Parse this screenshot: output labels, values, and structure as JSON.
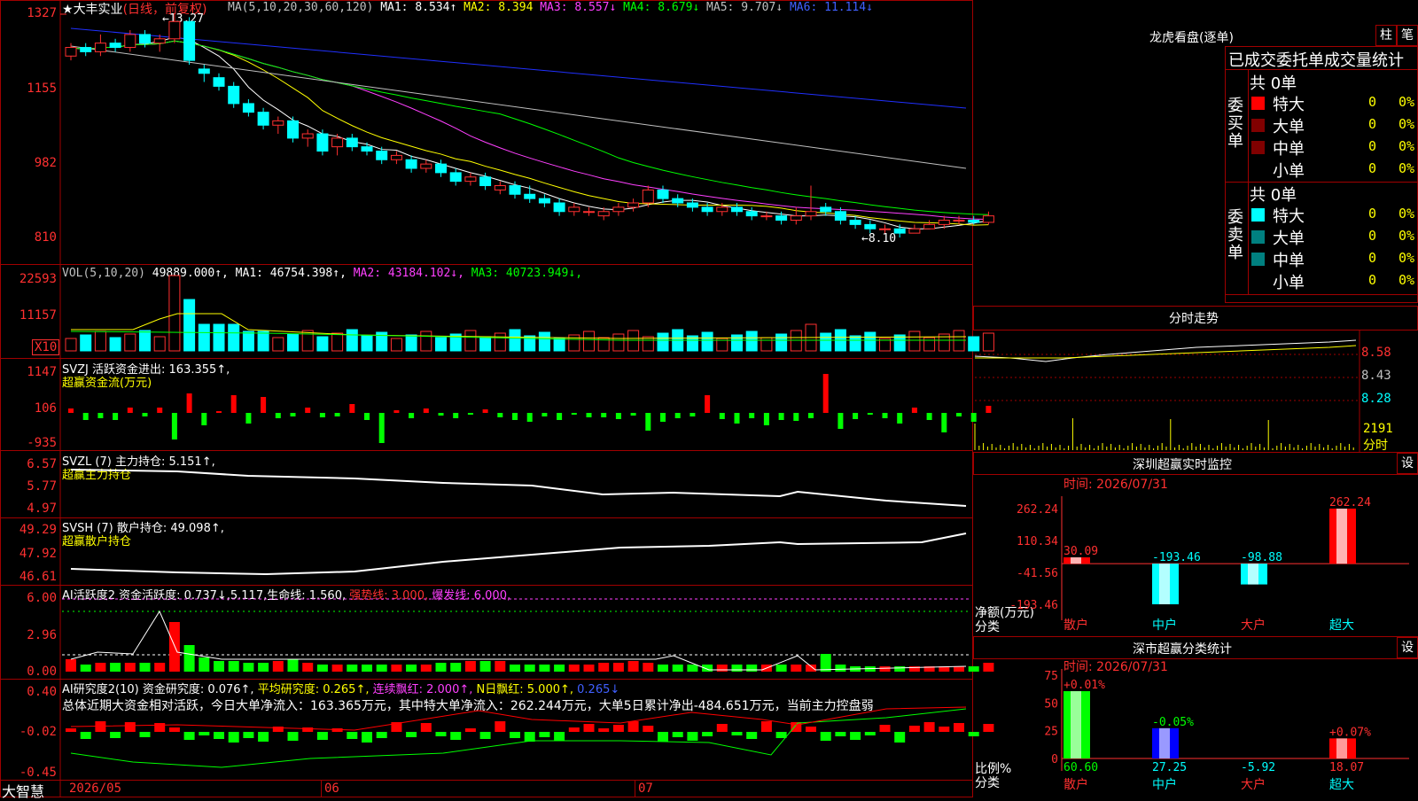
{
  "stock": {
    "name": "大丰实业",
    "period": "(日线，前复权)",
    "prefix": "★"
  },
  "app_name": "大智慧",
  "main_panel": {
    "ma_prefix": "MA(5,10,20,30,60,120)",
    "ma": [
      {
        "label": "MA1: 8.534↑",
        "color": "#ffffff"
      },
      {
        "label": "MA2: 8.394",
        "color": "#ffff00"
      },
      {
        "label": "MA3: 8.557↓",
        "color": "#ff40ff"
      },
      {
        "label": "MA4: 8.679↓",
        "color": "#00ff00"
      },
      {
        "label": "MA5: 9.707↓",
        "color": "#c0c0c0"
      },
      {
        "label": "MA6: 11.114↓",
        "color": "#4060ff"
      }
    ],
    "axis": [
      "1327",
      "1155",
      "982",
      "810"
    ],
    "high_label": "13.27",
    "low_label": "8.10",
    "candles": [
      [
        12.3,
        12.6,
        12.2,
        12.5
      ],
      [
        12.5,
        12.6,
        12.3,
        12.4
      ],
      [
        12.4,
        12.8,
        12.3,
        12.6
      ],
      [
        12.6,
        12.7,
        12.4,
        12.5
      ],
      [
        12.5,
        12.9,
        12.4,
        12.8
      ],
      [
        12.8,
        12.9,
        12.5,
        12.6
      ],
      [
        12.6,
        12.8,
        12.4,
        12.7
      ],
      [
        12.7,
        13.27,
        12.6,
        13.1
      ],
      [
        13.1,
        13.2,
        12.1,
        12.2
      ],
      [
        12.0,
        12.1,
        11.7,
        11.9
      ],
      [
        11.8,
        11.9,
        11.5,
        11.6
      ],
      [
        11.6,
        11.7,
        11.1,
        11.2
      ],
      [
        11.2,
        11.3,
        10.9,
        11.0
      ],
      [
        11.0,
        11.1,
        10.6,
        10.7
      ],
      [
        10.7,
        10.9,
        10.5,
        10.8
      ],
      [
        10.8,
        10.9,
        10.3,
        10.4
      ],
      [
        10.4,
        10.6,
        10.2,
        10.5
      ],
      [
        10.5,
        10.6,
        10.0,
        10.1
      ],
      [
        10.2,
        10.5,
        10.0,
        10.4
      ],
      [
        10.4,
        10.5,
        10.1,
        10.2
      ],
      [
        10.2,
        10.3,
        10.0,
        10.1
      ],
      [
        10.1,
        10.2,
        9.8,
        9.9
      ],
      [
        9.9,
        10.1,
        9.8,
        10.0
      ],
      [
        9.9,
        10.0,
        9.6,
        9.7
      ],
      [
        9.7,
        9.9,
        9.6,
        9.8
      ],
      [
        9.8,
        9.9,
        9.5,
        9.6
      ],
      [
        9.6,
        9.7,
        9.3,
        9.4
      ],
      [
        9.4,
        9.6,
        9.3,
        9.5
      ],
      [
        9.5,
        9.6,
        9.2,
        9.3
      ],
      [
        9.2,
        9.4,
        9.1,
        9.3
      ],
      [
        9.3,
        9.4,
        9.0,
        9.1
      ],
      [
        9.1,
        9.3,
        8.9,
        9.0
      ],
      [
        9.0,
        9.1,
        8.8,
        8.9
      ],
      [
        8.9,
        9.0,
        8.6,
        8.7
      ],
      [
        8.7,
        8.9,
        8.6,
        8.8
      ],
      [
        8.7,
        8.8,
        8.6,
        8.7
      ],
      [
        8.6,
        8.8,
        8.5,
        8.7
      ],
      [
        8.7,
        8.9,
        8.6,
        8.8
      ],
      [
        8.8,
        9.0,
        8.7,
        8.9
      ],
      [
        8.9,
        9.3,
        8.8,
        9.2
      ],
      [
        9.2,
        9.3,
        8.9,
        9.0
      ],
      [
        9.0,
        9.1,
        8.8,
        8.9
      ],
      [
        8.9,
        9.0,
        8.7,
        8.8
      ],
      [
        8.8,
        8.9,
        8.6,
        8.7
      ],
      [
        8.7,
        8.9,
        8.6,
        8.8
      ],
      [
        8.8,
        8.9,
        8.6,
        8.7
      ],
      [
        8.7,
        8.8,
        8.5,
        8.6
      ],
      [
        8.6,
        8.7,
        8.5,
        8.6
      ],
      [
        8.6,
        8.7,
        8.4,
        8.5
      ],
      [
        8.5,
        8.8,
        8.4,
        8.6
      ],
      [
        8.6,
        9.3,
        8.5,
        8.7
      ],
      [
        8.8,
        8.9,
        8.6,
        8.7
      ],
      [
        8.7,
        8.8,
        8.4,
        8.5
      ],
      [
        8.5,
        8.6,
        8.3,
        8.4
      ],
      [
        8.4,
        8.5,
        8.2,
        8.3
      ],
      [
        8.3,
        8.4,
        8.2,
        8.3
      ],
      [
        8.3,
        8.4,
        8.1,
        8.2
      ],
      [
        8.2,
        8.4,
        8.2,
        8.3
      ],
      [
        8.3,
        8.5,
        8.3,
        8.4
      ],
      [
        8.4,
        8.6,
        8.3,
        8.5
      ],
      [
        8.5,
        8.6,
        8.4,
        8.5
      ],
      [
        8.5,
        8.6,
        8.4,
        8.45
      ],
      [
        8.45,
        8.7,
        8.4,
        8.6
      ]
    ]
  },
  "vol_panel": {
    "title": "VOL(5,10,20)",
    "value": "49889.000↑,",
    "ma": [
      {
        "label": "MA1: 46754.398↑",
        "color": "#ffffff"
      },
      {
        "label": "MA2: 43184.102↓",
        "color": "#ff40ff"
      },
      {
        "label": "MA3: 40723.949↓",
        "color": "#00ff00"
      }
    ],
    "axis": [
      "22593",
      "11157"
    ],
    "unit": "X10"
  },
  "svzj_panel": {
    "title": "SVZJ  活跃资金进出: 163.355↑,",
    "subtitle": "超赢资金流(万元)",
    "axis": [
      "1147",
      "106",
      "-935"
    ]
  },
  "svzl_panel": {
    "title": "SVZL (7) 主力持仓: 5.151↑,",
    "subtitle": "超赢主力持仓",
    "axis": [
      "6.57",
      "5.77",
      "4.97"
    ]
  },
  "svsh_panel": {
    "title": "SVSH (7) 散户持仓: 49.098↑,",
    "subtitle": "超赢散户持仓",
    "axis": [
      "49.29",
      "47.92",
      "46.61"
    ]
  },
  "ai_active_panel": {
    "title": "AI活跃度2 资金活跃度: 0.737↓,5.117,生命线: 1.560,",
    "strong": "强势线: 3.000,",
    "burst": "爆发线: 6.000,",
    "axis": [
      "6.00",
      "2.96",
      "0.00"
    ]
  },
  "ai_research_panel": {
    "title": "AI研究度2(10) 资金研究度: 0.076↑,",
    "avg": "平均研究度: 0.265↑,",
    "cont": "连续飘红: 2.000↑,",
    "nday": "N日飘红: 5.000↑,",
    "last": "0.265↓",
    "summary": "总体近期大资金相对活跃，今日大单净流入：163.365万元，其中特大单净流入：262.244万元，大单5日累计净出-484.651万元，当前主力控盘弱",
    "axis": [
      "0.40",
      "-0.02",
      "-0.45"
    ]
  },
  "time_axis": [
    "2026/05",
    "06",
    "07"
  ],
  "lhb": {
    "title": "龙虎看盘(逐单)",
    "btn1": "柱",
    "btn2": "笔",
    "header": "已成交委托单成交量统计",
    "buy": {
      "side": "委买单",
      "total": "共 0单",
      "rows": [
        {
          "name": "特大",
          "val": "0",
          "pct": "0%",
          "color": "#ff0000"
        },
        {
          "name": "大单",
          "val": "0",
          "pct": "0%",
          "color": "#800000"
        },
        {
          "name": "中单",
          "val": "0",
          "pct": "0%",
          "color": "#800000"
        },
        {
          "name": "小单",
          "val": "0",
          "pct": "0%",
          "color": ""
        }
      ]
    },
    "sell": {
      "side": "委卖单",
      "total": "共 0单",
      "rows": [
        {
          "name": "特大",
          "val": "0",
          "pct": "0%",
          "color": "#00ffff"
        },
        {
          "name": "大单",
          "val": "0",
          "pct": "0%",
          "color": "#008080"
        },
        {
          "name": "中单",
          "val": "0",
          "pct": "0%",
          "color": "#008080"
        },
        {
          "name": "小单",
          "val": "0",
          "pct": "0%",
          "color": ""
        }
      ]
    }
  },
  "intraday": {
    "title": "分时走势",
    "axis": [
      "8.58",
      "8.43",
      "8.28",
      "2191"
    ],
    "unit": "分时"
  },
  "sz_monitor": {
    "title": "深圳超赢实时监控",
    "btn": "设",
    "time": "时间: 2026/07/31",
    "axis": [
      "262.24",
      "110.34",
      "-41.56",
      "-193.46"
    ],
    "ylabel": "净额(万元)",
    "xlabel": "分类",
    "bars": [
      {
        "cat": "散户",
        "value": 30.09,
        "label": "30.09"
      },
      {
        "cat": "中户",
        "value": -193.46,
        "label": "-193.46"
      },
      {
        "cat": "大户",
        "value": -98.88,
        "label": "-98.88"
      },
      {
        "cat": "超大",
        "value": 262.24,
        "label": "262.24"
      }
    ]
  },
  "sz_class": {
    "title": "深市超赢分类统计",
    "btn": "设",
    "time": "时间: 2026/07/31",
    "axis": [
      "75",
      "50",
      "25",
      "0"
    ],
    "ylabel": "比例%",
    "xlabel": "分类",
    "bars": [
      {
        "cat": "散户",
        "value": 60.6,
        "label": "60.60",
        "top": "+0.01%",
        "color": "#00ff00"
      },
      {
        "cat": "中户",
        "value": 27.25,
        "label": "27.25",
        "top": "-0.05%",
        "color": "#0000ff"
      },
      {
        "cat": "大户",
        "value": -5.92,
        "label": "-5.92",
        "top": "",
        "color": "#00ffff"
      },
      {
        "cat": "超大",
        "value": 18.07,
        "label": "18.07",
        "top": "+0.07%",
        "color": "#ff0000"
      }
    ]
  }
}
